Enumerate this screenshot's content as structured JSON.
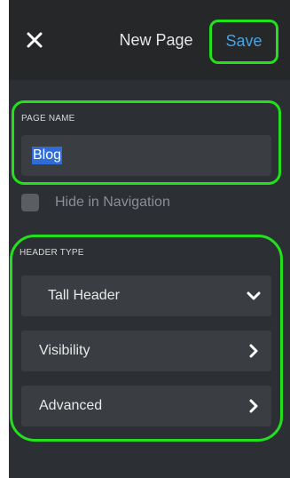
{
  "header": {
    "title": "New Page",
    "save_label": "Save",
    "close_icon": "close-icon"
  },
  "page_name": {
    "section_label": "PAGE NAME",
    "value": "Blog"
  },
  "hide_in_navigation": {
    "label": "Hide in Navigation",
    "checked": false
  },
  "header_type": {
    "section_label": "HEADER TYPE",
    "selected": "Tall Header",
    "rows": [
      {
        "label": "Visibility",
        "icon": "chevron-right-icon"
      },
      {
        "label": "Advanced",
        "icon": "chevron-right-icon"
      }
    ]
  },
  "colors": {
    "panel_bg": "#2c2f33",
    "header_bg": "#252729",
    "accent_blue": "#4aa3df",
    "highlight_green": "#22e01c",
    "selection_blue": "#2f6cd6"
  }
}
